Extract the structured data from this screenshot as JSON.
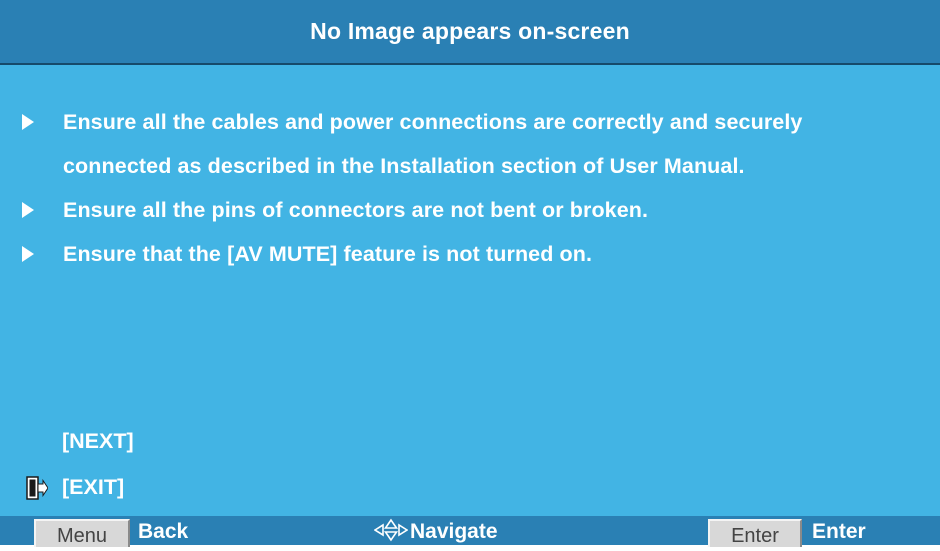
{
  "header": {
    "title": "No Image appears on-screen"
  },
  "content": {
    "bullets": [
      {
        "lines": [
          "Ensure all the cables and power connections are correctly and securely",
          "connected as described in the Installation section of User Manual."
        ]
      },
      {
        "lines": [
          "Ensure all the pins of connectors are not bent or broken."
        ]
      },
      {
        "lines": [
          "Ensure that the [AV MUTE] feature is not turned on."
        ]
      }
    ]
  },
  "menu": {
    "next_label": "[NEXT]",
    "exit_label": "[EXIT]",
    "exit_icon": "exit-door-icon"
  },
  "footer": {
    "menu_key": "Menu",
    "back_label": "Back",
    "navigate_icon": "navigate-arrows-icon",
    "navigate_label": "Navigate",
    "enter_key": "Enter",
    "enter_label": "Enter"
  },
  "colors": {
    "background": "#42b4e4",
    "bar": "#2a80b4",
    "text": "#ffffff",
    "key_button": "#d8d8d8"
  }
}
